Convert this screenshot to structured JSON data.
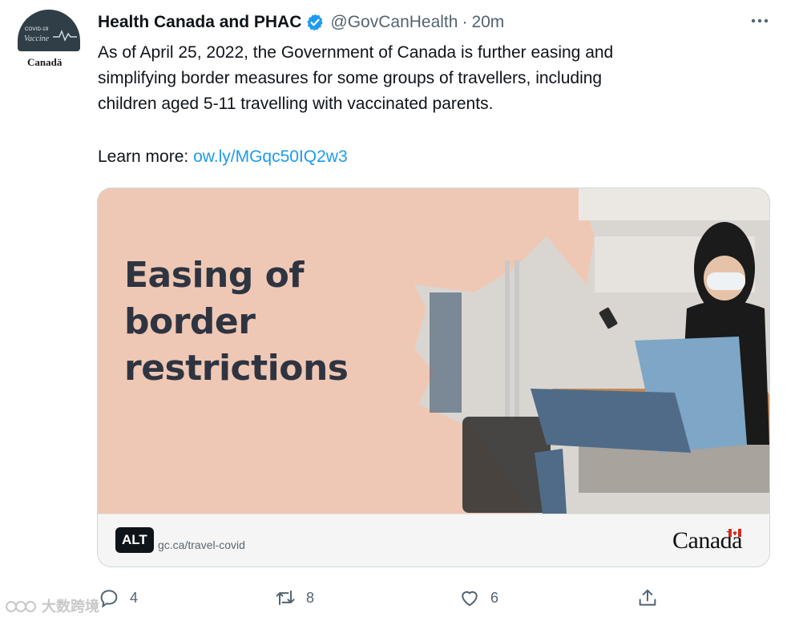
{
  "avatar": {
    "badge_line1": "COVID-19",
    "badge_line2": "Vaccine",
    "wordmark": "Canadä"
  },
  "header": {
    "name": "Health Canada and PHAC",
    "handle": "@GovCanHealth",
    "separator": "·",
    "time": "20m"
  },
  "tweet": {
    "line1": "As of April 25, 2022, the Government of Canada is further easing and",
    "line2": "simplifying border measures for some groups of travellers, including",
    "line3": "children aged 5-11 travelling with vaccinated parents.",
    "learn_label": "Learn more:",
    "link_text": "ow.ly/MGqc50IQ2w3"
  },
  "card": {
    "headline_line1": "Easing of",
    "headline_line2": "border",
    "headline_line3": "restrictions",
    "alt_badge": "ALT",
    "url": "gc.ca/travel-covid",
    "wordmark": "Canadä"
  },
  "actions": {
    "reply_count": "4",
    "retweet_count": "8",
    "like_count": "6"
  },
  "watermark": {
    "text": "大数跨境"
  },
  "colors": {
    "link": "#1d9bf0",
    "card_bg": "#efc8b5",
    "headline": "#2f3441",
    "secondary_text": "#536471"
  }
}
